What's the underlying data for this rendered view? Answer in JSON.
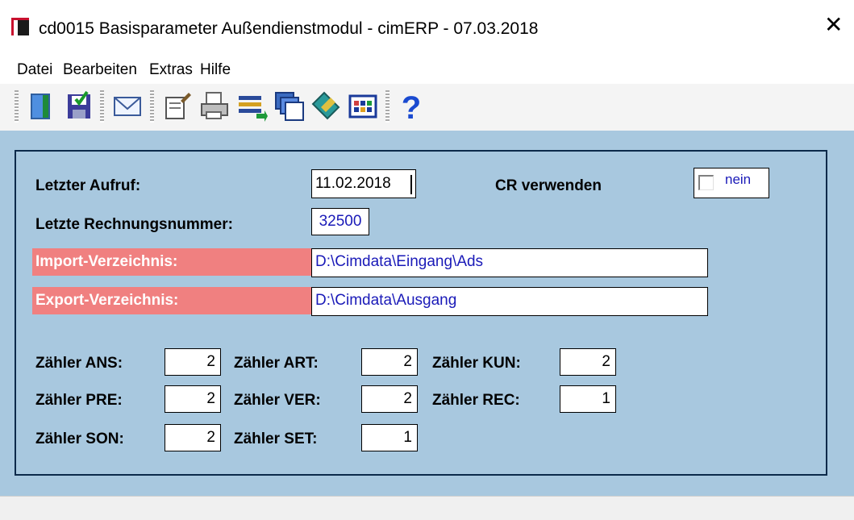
{
  "window": {
    "title": "cd0015 Basisparameter Außendienstmodul - cimERP - 07.03.2018",
    "close_glyph": "✕",
    "icon": "cimerp-app-icon"
  },
  "menu": {
    "items": [
      {
        "label": "Datei"
      },
      {
        "label": "Bearbeiten"
      },
      {
        "label": "Extras"
      },
      {
        "label": "Hilfe"
      }
    ]
  },
  "toolbar": {
    "buttons": [
      {
        "icon": "exit-door-icon"
      },
      {
        "icon": "save-disk-icon"
      },
      {
        "icon": "mail-envelope-icon"
      },
      {
        "icon": "edit-note-icon"
      },
      {
        "icon": "printer-icon"
      },
      {
        "icon": "transfer-list-icon"
      },
      {
        "icon": "windows-stack-icon"
      },
      {
        "icon": "tag-label-icon"
      },
      {
        "icon": "calendar-grid-icon"
      },
      {
        "icon": "help-question-icon"
      }
    ]
  },
  "form": {
    "letzter_aufruf": {
      "label": "Letzter Aufruf:",
      "value": "11.02.2018"
    },
    "cr_verwenden": {
      "label": "CR verwenden",
      "value": "nein",
      "checked": false
    },
    "letzte_rechnungsnummer": {
      "label": "Letzte Rechnungsnummer:",
      "value": "32500"
    },
    "import_verzeichnis": {
      "label": "Import-Verzeichnis:",
      "value": "D:\\Cimdata\\Eingang\\Ads"
    },
    "export_verzeichnis": {
      "label": "Export-Verzeichnis:",
      "value": "D:\\Cimdata\\Ausgang"
    },
    "counters": [
      {
        "label": "Zähler ANS:",
        "value": "2"
      },
      {
        "label": "Zähler ART:",
        "value": "2"
      },
      {
        "label": "Zähler KUN:",
        "value": "2"
      },
      {
        "label": "Zähler PRE:",
        "value": "2"
      },
      {
        "label": "Zähler VER:",
        "value": "2"
      },
      {
        "label": "Zähler REC:",
        "value": "1"
      },
      {
        "label": "Zähler SON:",
        "value": "2"
      },
      {
        "label": "Zähler SET:",
        "value": "1"
      }
    ]
  },
  "colors": {
    "client_bg": "#a8c8df",
    "panel_border": "#0b2a4a",
    "label_pink": "#f08080",
    "value_blue": "#1a1ab8"
  }
}
